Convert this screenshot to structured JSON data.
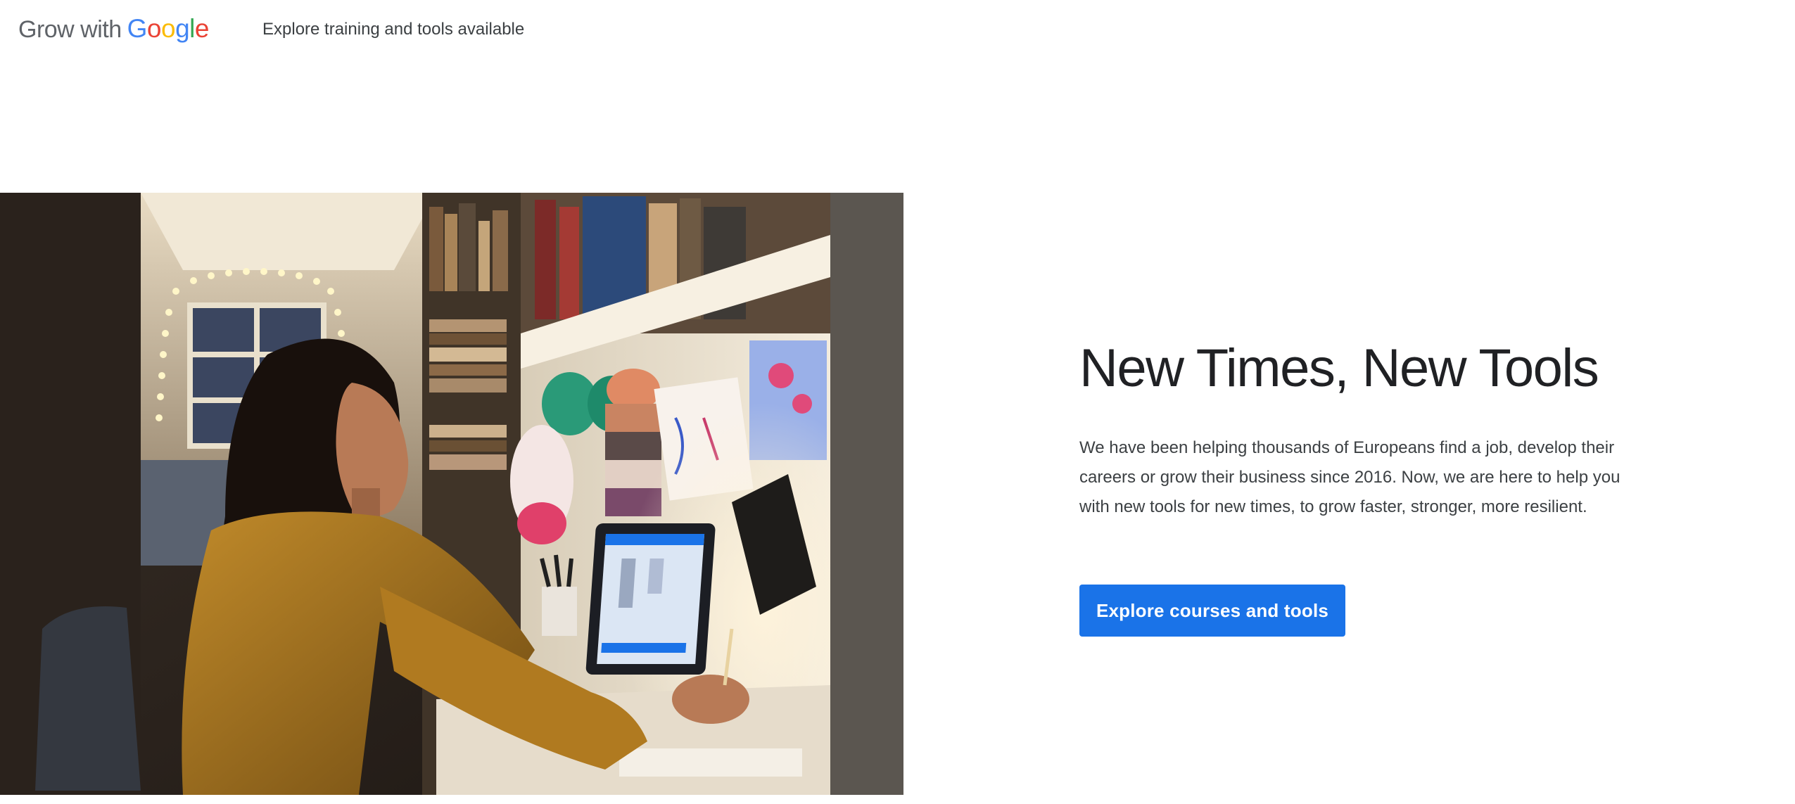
{
  "header": {
    "logo": {
      "prefix": "Grow with",
      "google_letters": [
        {
          "char": "G",
          "color": "#4285f4"
        },
        {
          "char": "o",
          "color": "#ea4335"
        },
        {
          "char": "o",
          "color": "#fbbc05"
        },
        {
          "char": "g",
          "color": "#4285f4"
        },
        {
          "char": "l",
          "color": "#34a853"
        },
        {
          "char": "e",
          "color": "#ea4335"
        }
      ]
    },
    "nav_link": "Explore training and tools available"
  },
  "hero": {
    "title": "New Times, New Tools",
    "body": "We have been helping thousands of Europeans find a job, develop their careers or grow their business since 2016. Now, we are here to help you with new tools for new times, to grow faster, stronger, more resilient.",
    "cta_label": "Explore courses and tools",
    "image_icon": "photo-woman-at-desk-with-laptop"
  },
  "colors": {
    "accent": "#1a73e8",
    "title_text": "#202124",
    "body_text": "#3c4043"
  }
}
